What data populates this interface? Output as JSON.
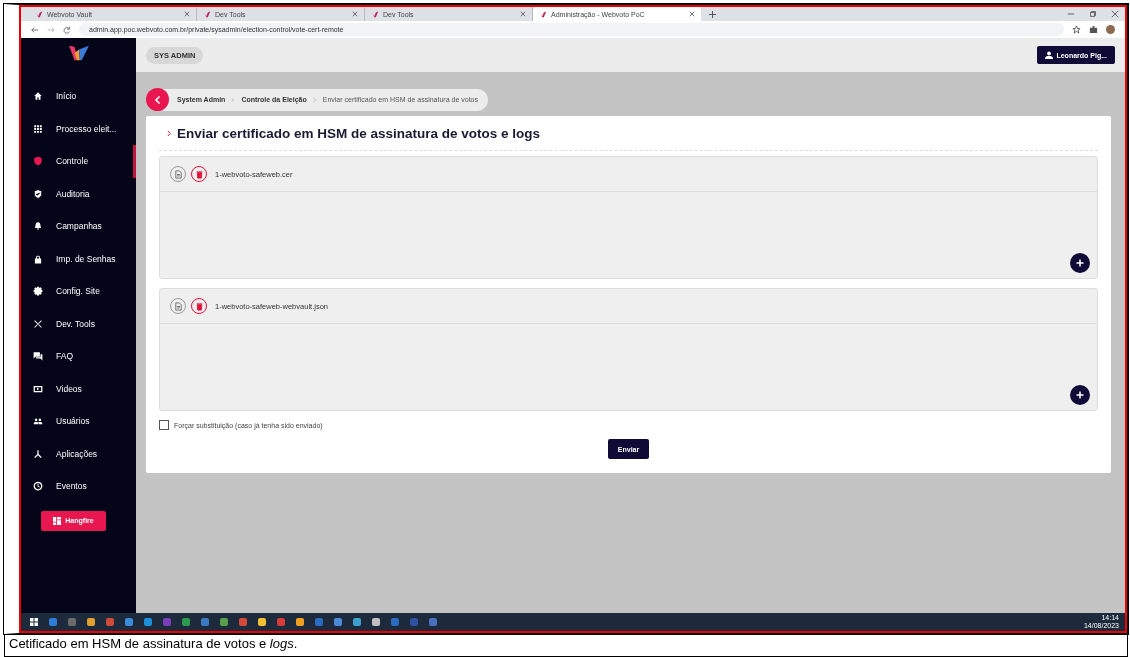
{
  "browser": {
    "tabs": [
      {
        "title": "Webvoto Vault",
        "selected": false
      },
      {
        "title": "Dev Tools",
        "selected": false
      },
      {
        "title": "Dev Tools",
        "selected": false
      },
      {
        "title": "Administração - Webvoto PoC",
        "selected": true
      }
    ],
    "url": "admin.app.poc.webvoto.com.br/private/sysadmin/election-control/vote-cert-remote"
  },
  "sidebar": {
    "items": [
      {
        "label": "Início",
        "selected": false
      },
      {
        "label": "Processo eleit...",
        "selected": false
      },
      {
        "label": "Controle",
        "selected": true
      },
      {
        "label": "Auditoria",
        "selected": false
      },
      {
        "label": "Campanhas",
        "selected": false
      },
      {
        "label": "Imp. de Senhas",
        "selected": false
      },
      {
        "label": "Config. Site",
        "selected": false
      },
      {
        "label": "Dev. Tools",
        "selected": false
      },
      {
        "label": "FAQ",
        "selected": false
      },
      {
        "label": "Videos",
        "selected": false
      },
      {
        "label": "Usuários",
        "selected": false
      },
      {
        "label": "Aplicações",
        "selected": false
      },
      {
        "label": "Eventos",
        "selected": false
      }
    ],
    "button": "Hangfire"
  },
  "header": {
    "role": "SYS ADMIN",
    "user": "Leonardo Pig..."
  },
  "breadcrumb": [
    "System Admin",
    "Controle da Eleição",
    "Enviar certificado em HSM de assinatura de votos"
  ],
  "title": "Enviar certificado em HSM de assinatura de votos e logs",
  "files": [
    {
      "name": "1-webvoto-safeweb.cer"
    },
    {
      "name": "1-webvoto-safeweb-webvault.json"
    }
  ],
  "force": {
    "label": "Forçar substituição (caso já tenha sido enviado)",
    "checked": false
  },
  "submit": "Enviar",
  "taskbar": {
    "time": "14:14",
    "date": "14/08/2023"
  },
  "caption": "Cetificado em HSM de assinatura de votos e *logs*."
}
